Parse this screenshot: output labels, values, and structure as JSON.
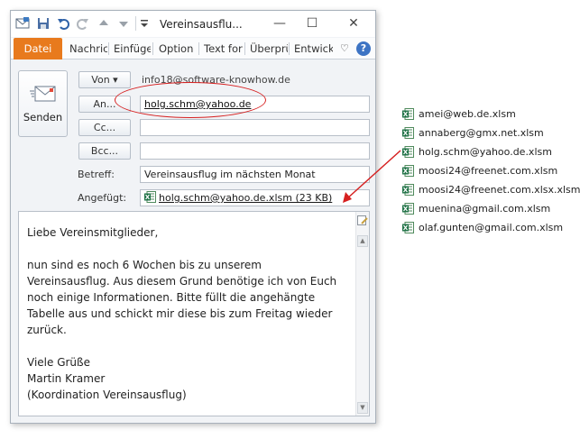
{
  "window": {
    "title": "Vereinsausflu...",
    "controls": {
      "minimize": "—",
      "maximize": "☐",
      "close": "✕"
    }
  },
  "quick_access": {
    "save_icon": "save-icon",
    "undo_icon": "undo-icon",
    "redo_icon": "redo-icon",
    "up_icon": "arrow-up-icon",
    "down_icon": "arrow-down-icon",
    "customize_icon": "customize-icon"
  },
  "ribbon": {
    "tabs": [
      {
        "label": "Datei"
      },
      {
        "label": "Nachric"
      },
      {
        "label": "Einfüge"
      },
      {
        "label": "Option"
      },
      {
        "label": "Text for"
      },
      {
        "label": "Überprü"
      },
      {
        "label": "Entwick"
      }
    ],
    "collapse_glyph": "♡",
    "help_glyph": "?"
  },
  "message": {
    "send_label": "Senden",
    "from_button": "Von ▾",
    "from_value": "info18@software-knowhow.de",
    "to_button": "An...",
    "to_value": "holg.schm@yahoo.de",
    "cc_button": "Cc...",
    "cc_value": "",
    "bcc_button": "Bcc...",
    "bcc_value": "",
    "subject_label": "Betreff:",
    "subject_value": "Vereinsausflug im nächsten Monat",
    "attached_label": "Angefügt:",
    "attachment": "holg.schm@yahoo.de.xlsm (23 KB)"
  },
  "body": {
    "greeting": "Liebe Vereinsmitglieder,",
    "lines": [
      "nun sind es noch 6 Wochen bis zu unserem",
      "Vereinsausflug. Aus diesem Grund benötige ich von Euch",
      "noch einige Informationen. Bitte füllt die angehängte",
      "Tabelle aus und schickt mir diese bis zum Freitag wieder",
      "zurück."
    ],
    "closing": "Viele Grüße",
    "name": "Martin Kramer",
    "role": "(Koordination Vereinsausflug)"
  },
  "files": [
    "amei@web.de.xlsm",
    "annaberg@gmx.net.xlsm",
    "holg.schm@yahoo.de.xlsm",
    "moosi24@freenet.com.xlsm",
    "moosi24@freenet.com.xlsx.xlsm",
    "muenina@gmail.com.xlsm",
    "olaf.gunten@gmail.com.xlsm"
  ],
  "colors": {
    "file_tab": "#e87a1d",
    "callout": "#d62020",
    "excel_green": "#1e7145"
  }
}
